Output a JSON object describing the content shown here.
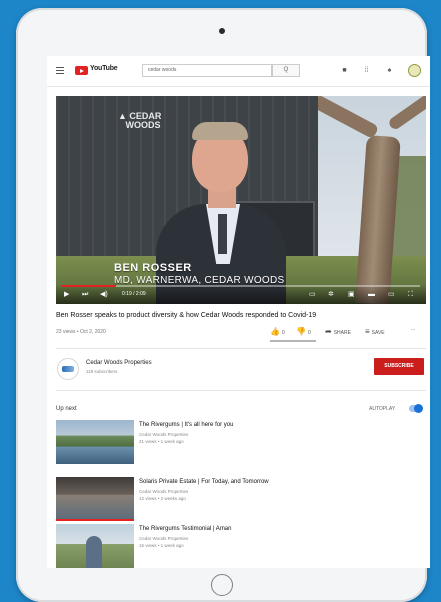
{
  "header": {
    "brand": "YouTube",
    "search": {
      "value": "cedar woods",
      "button": "Q"
    }
  },
  "video": {
    "overlay_name": "BEN ROSSER",
    "overlay_role": "MD, WARNERWA, CEDAR WOODS",
    "time": "0:19 / 2:09",
    "progress": 0.15
  },
  "info": {
    "title": "Ben Rosser speaks to product diversity & how Cedar Woods responded to Covid-19",
    "meta": "23 views • Oct 2, 2020",
    "likes": "0",
    "dislikes": "0",
    "share": "SHARE",
    "save": "SAVE",
    "more": "..."
  },
  "channel": {
    "name": "Cedar Woods Properties",
    "subscribers": "119 subscribers",
    "subscribe_label": "SUBSCRIBE"
  },
  "up_next": {
    "label": "Up next",
    "autoplay_label": "AUTOPLAY",
    "autoplay_on": true,
    "items": [
      {
        "title": "The Rivergums | It's all here for you",
        "channel": "Cedar Woods Properties",
        "stats": "21 views • 1 week ago"
      },
      {
        "title": "Solaris Private Estate | For Today, and Tomorrow",
        "channel": "Cedar Woods Properties",
        "stats": "12 views • 2 weeks ago"
      },
      {
        "title": "The Rivergums Testimonial | Aman",
        "channel": "Cedar Woods Properties",
        "stats": "15 views • 1 week ago"
      }
    ]
  },
  "colors": {
    "accent_red": "#cc1d1d",
    "progress_red": "#e52222",
    "toggle_blue": "#1a6fd8",
    "background_blue": "#1d86c8"
  }
}
